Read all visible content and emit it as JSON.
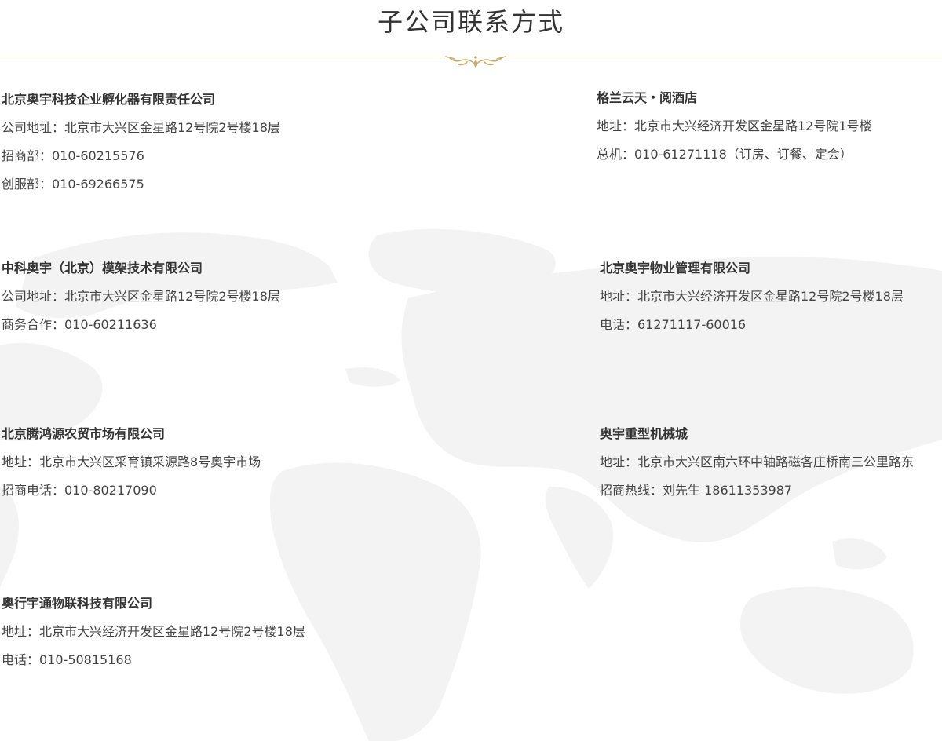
{
  "page": {
    "title": "子公司联系方式"
  },
  "companies": [
    {
      "name": "北京奥宇科技企业孵化器有限责任公司",
      "lines": [
        "公司地址：北京市大兴区金星路12号院2号楼18层",
        "招商部：010-60215576",
        "创服部：010-69266575"
      ]
    },
    {
      "name": "格兰云天・阅酒店",
      "lines": [
        "地址：北京市大兴经济开发区金星路12号院1号楼",
        "总机：010-61271118（订房、订餐、定会）"
      ]
    },
    {
      "name": "中科奥宇（北京）模架技术有限公司",
      "lines": [
        "公司地址：北京市大兴区金星路12号院2号楼18层",
        "商务合作：010-60211636"
      ]
    },
    {
      "name": "北京奥宇物业管理有限公司",
      "lines": [
        "地址：北京市大兴经济开发区金星路12号院2号楼18层",
        "电话：61271117-60016"
      ]
    },
    {
      "name": "北京腾鸿源农贸市场有限公司",
      "lines": [
        "地址：北京市大兴区采育镇采源路8号奥宇市场",
        "招商电话：010-80217090"
      ]
    },
    {
      "name": "奥宇重型机械城",
      "lines": [
        "地址：北京市大兴区南六环中轴路磁各庄桥南三公里路东",
        "招商热线：刘先生 18611353987"
      ]
    },
    {
      "name": "奥行宇通物联科技有限公司",
      "lines": [
        "地址：北京市大兴经济开发区金星路12号院2号楼18层",
        "电话：010-50815168"
      ]
    }
  ],
  "colors": {
    "accent_gold": "#d9c79a",
    "ornament_gold": "#c9ad6e",
    "text": "#333333",
    "map_gray": "#f3f3f3"
  },
  "icons": {
    "ornament": "gold-scroll-ornament",
    "background": "world-map"
  }
}
